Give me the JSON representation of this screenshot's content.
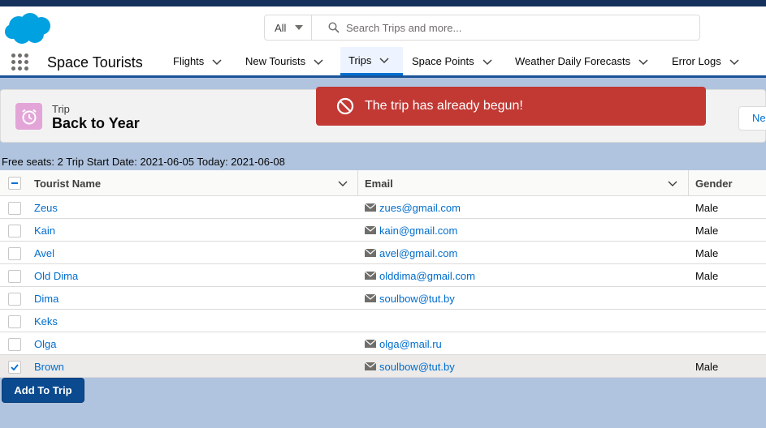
{
  "search": {
    "scope": "All",
    "placeholder": "Search Trips and more..."
  },
  "nav": {
    "app_name": "Space Tourists",
    "tabs": [
      {
        "label": "Flights"
      },
      {
        "label": "New Tourists"
      },
      {
        "label": "Trips"
      },
      {
        "label": "Space Points"
      },
      {
        "label": "Weather Daily Forecasts"
      },
      {
        "label": "Error Logs"
      }
    ]
  },
  "record": {
    "type": "Trip",
    "title": "Back to Year",
    "new_button": "Ne"
  },
  "toast": {
    "message": "The trip has already begun!"
  },
  "info_line": "Free seats: 2 Trip Start Date: 2021-06-05 Today: 2021-06-08",
  "table": {
    "columns": [
      "Tourist Name",
      "Email",
      "Gender"
    ],
    "rows": [
      {
        "name": "Zeus",
        "email": "zues@gmail.com",
        "gender": "Male",
        "checked": false
      },
      {
        "name": "Kain",
        "email": "kain@gmail.com",
        "gender": "Male",
        "checked": false
      },
      {
        "name": "Avel",
        "email": "avel@gmail.com",
        "gender": "Male",
        "checked": false
      },
      {
        "name": "Old Dima",
        "email": "olddima@gmail.com",
        "gender": "Male",
        "checked": false
      },
      {
        "name": "Dima",
        "email": "soulbow@tut.by",
        "gender": "",
        "checked": false
      },
      {
        "name": "Keks",
        "email": "",
        "gender": "",
        "checked": false
      },
      {
        "name": "Olga",
        "email": "olga@mail.ru",
        "gender": "",
        "checked": false
      },
      {
        "name": "Brown",
        "email": "soulbow@tut.by",
        "gender": "Male",
        "checked": true
      }
    ]
  },
  "add_button": "Add To Trip",
  "colors": {
    "brand": "#0070d2",
    "toast_error": "#c23934",
    "primary_button": "#0b4a8f"
  }
}
